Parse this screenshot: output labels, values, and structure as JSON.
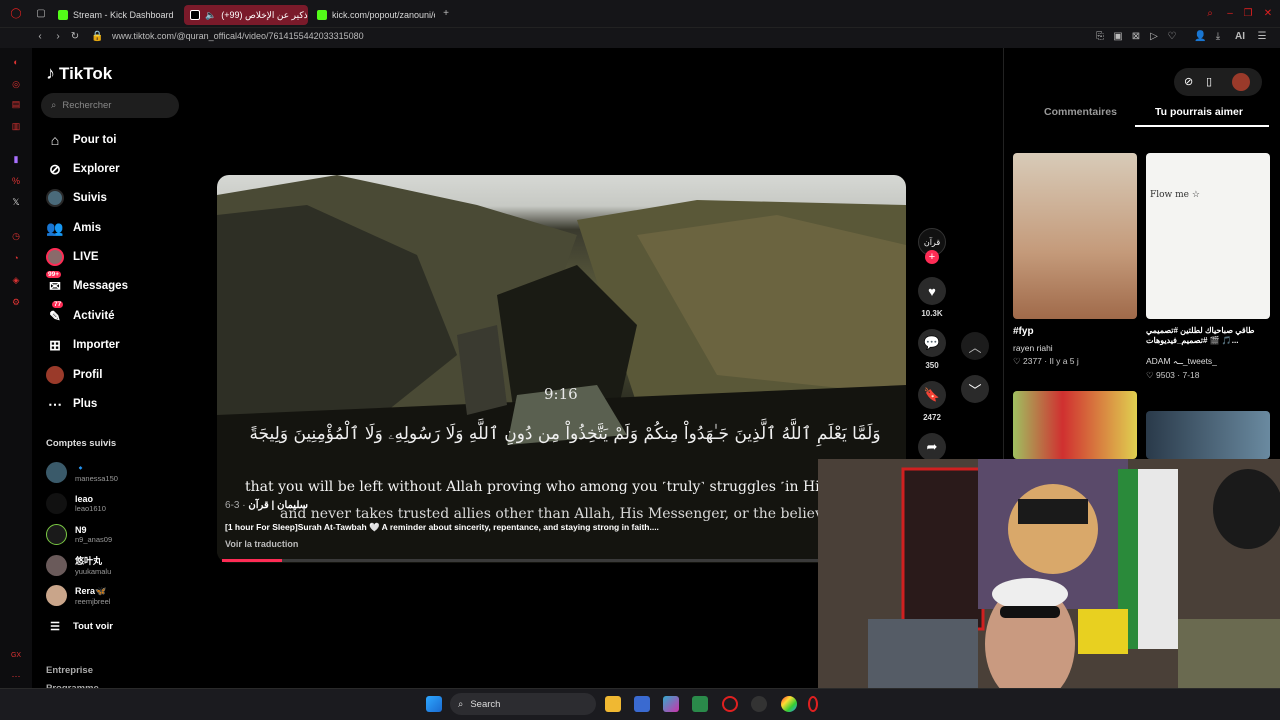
{
  "browser": {
    "tabs": [
      {
        "label": "Stream - Kick Dashboard",
        "active": false
      },
      {
        "label": "(+99) اذكير عن الإخلاص",
        "active": true
      },
      {
        "label": "kick.com/popout/zanouni/c",
        "active": false
      }
    ],
    "url": "www.tiktok.com/@quran_offical4/video/7614155442033315080",
    "ai_label": "AI"
  },
  "tiktok": {
    "logo": "TikTok",
    "search_placeholder": "Rechercher",
    "nav": [
      {
        "label": "Pour toi",
        "icon": "home-icon"
      },
      {
        "label": "Explorer",
        "icon": "compass-icon"
      },
      {
        "label": "Suivis",
        "icon": "avatar-icon"
      },
      {
        "label": "Amis",
        "icon": "friends-icon"
      },
      {
        "label": "LIVE",
        "icon": "live-icon"
      },
      {
        "label": "Messages",
        "icon": "messages-icon",
        "badge": "99+"
      },
      {
        "label": "Activité",
        "icon": "activity-icon",
        "badge": "77"
      },
      {
        "label": "Importer",
        "icon": "upload-icon"
      },
      {
        "label": "Profil",
        "icon": "profile-icon"
      },
      {
        "label": "Plus",
        "icon": "more-icon"
      }
    ],
    "followed_title": "Comptes suivis",
    "followed": [
      {
        "name": "🔹",
        "handle": "manessa150"
      },
      {
        "name": "leao",
        "handle": "leao1610"
      },
      {
        "name": "N9",
        "handle": "n9_anas09"
      },
      {
        "name": "悠叶丸",
        "handle": "yuukamalu"
      },
      {
        "name": "Rera🦋",
        "handle": "reemjbreel"
      }
    ],
    "see_all": "Tout voir",
    "footer": [
      "Entreprise",
      "Programme"
    ]
  },
  "video": {
    "timecode": "9:16",
    "arabic": "وَلَمَّا يَعْلَمِ ٱللَّهُ ٱلَّذِينَ جَـٰهَدُواْ مِنكُمْ وَلَمْ يَتَّخِذُواْ مِن دُونِ ٱللَّهِ وَلَا رَسُولِهِۦ وَلَا ٱلْمُؤْمِنِينَ وَلِيجَةً",
    "subtitle_1": "that you will be left without Allah proving who among you ˹truly˺ struggles ˹in Hi",
    "subtitle_2": "and never takes trusted allies other than Allah, His Messenger, or the believe",
    "author": "سليمان | قرآن",
    "date": "3-6",
    "description": "[1 hour For Sleep]Surah At-Tawbah 🤍 A reminder about sincerity, repentance, and staying strong in faith....",
    "translate": "Voir la traduction",
    "progress": 0.1,
    "likes": "10.3K",
    "comments": "350",
    "saves": "2472",
    "creator_badge": "قرآن"
  },
  "right_panel": {
    "tabs": [
      "Commentaires",
      "Tu pourrais aimer"
    ],
    "active_tab": "Tu pourrais aimer",
    "cards": [
      {
        "title": "#fyp",
        "author": "rayen riahi",
        "likes": "2377",
        "time": "Il y a 5 j",
        "overlay": ""
      },
      {
        "title": "طاقي صباحياك لطلتين #تصميمي #تصميم_فيديوهات 🎬 🎵...",
        "author": "ADAM ـہ_tweets_",
        "likes": "9503",
        "time": "7-18",
        "overlay": "Flow me ☆"
      }
    ]
  },
  "taskbar": {
    "search": "Search"
  }
}
